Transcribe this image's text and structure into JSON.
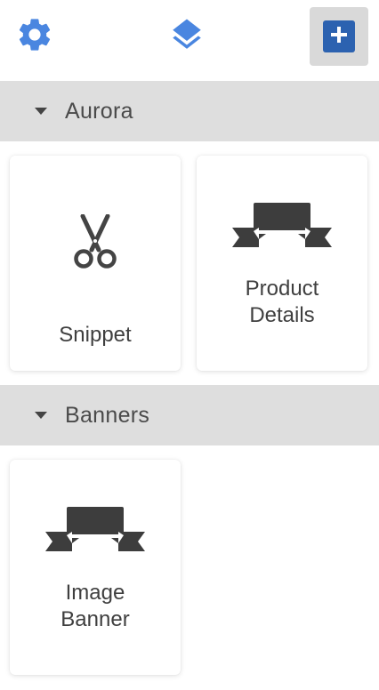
{
  "toolbar": {
    "settings_icon": "gear-icon",
    "layers_icon": "layers-icon",
    "add_icon": "plus-icon",
    "accent_color": "#4a86e0",
    "add_button_color": "#2c62b0"
  },
  "categories": [
    {
      "label": "Aurora",
      "expanded": true,
      "blocks": [
        {
          "label": "Snippet",
          "icon": "scissors-icon"
        },
        {
          "label": "Product\nDetails",
          "icon": "banner-icon"
        }
      ]
    },
    {
      "label": "Banners",
      "expanded": true,
      "blocks": [
        {
          "label": "Image\nBanner",
          "icon": "banner-icon"
        }
      ]
    }
  ]
}
